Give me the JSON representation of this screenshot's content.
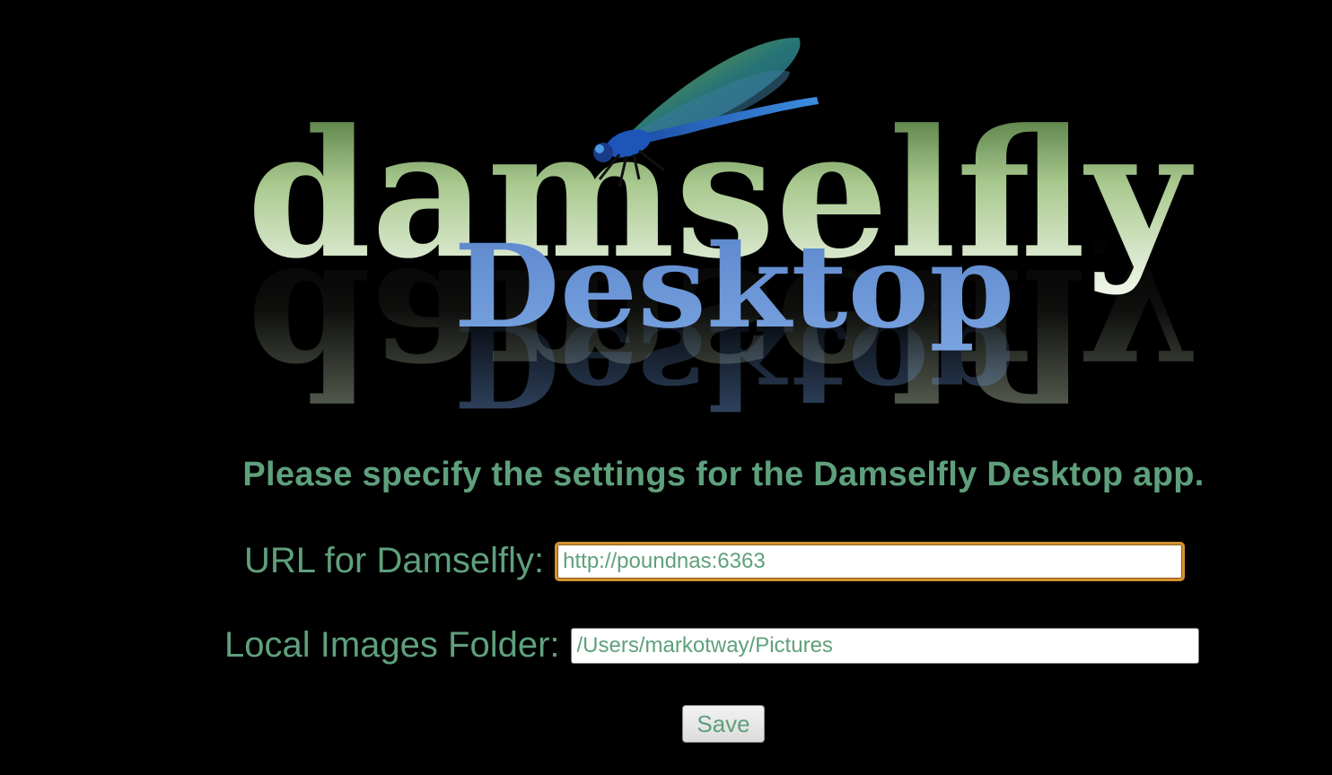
{
  "logo": {
    "word_main": "damselfly",
    "word_sub": "Desktop",
    "main_color_top": "#4f7a3c",
    "main_color_bottom": "#f3f8ee",
    "sub_color": "#6a96d6"
  },
  "form": {
    "intro_text": "Please specify the settings for the Damselfly Desktop app.",
    "url_label": "URL for Damselfly:",
    "url_value": "http://poundnas:6363",
    "folder_label": "Local Images Folder:",
    "folder_value": "/Users/markotway/Pictures",
    "save_label": "Save"
  },
  "colors": {
    "background": "#000000",
    "text_green": "#5fa07c",
    "focus_ring": "#d4922e"
  }
}
